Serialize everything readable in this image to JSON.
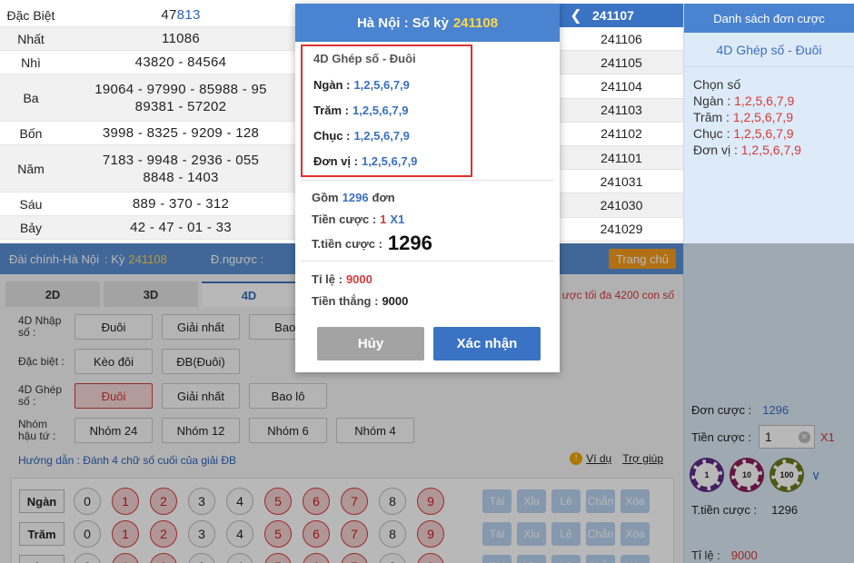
{
  "results": [
    {
      "label": "Đặc Biệt",
      "prefix": "47",
      "highlight": "813"
    },
    {
      "label": "Nhất",
      "value": "11086"
    },
    {
      "label": "Nhì",
      "value": "43820  -  84564"
    },
    {
      "label": "Ba",
      "value": "19064  -  97990  -  85988  -  95\n89381  -  57202"
    },
    {
      "label": "Bốn",
      "value": "3998  -  8325  -  9209  -  128"
    },
    {
      "label": "Năm",
      "value": "7183  -  9948  -  2936  -  055\n8848  -  1403"
    },
    {
      "label": "Sáu",
      "value": "889  -  370  -  312"
    },
    {
      "label": "Bảy",
      "value": "42  -  47  -  01  -  33"
    }
  ],
  "periods": {
    "header": "241107",
    "items": [
      "241106",
      "241105",
      "241104",
      "241103",
      "241102",
      "241101",
      "241031",
      "241030",
      "241029"
    ]
  },
  "right_panel": {
    "header": "Danh sách đơn cược",
    "bet_type": "4D Ghép số - Đuôi",
    "choose_label": "Chọn số",
    "picks": [
      {
        "label": "Ngàn :",
        "value": "1,2,5,6,7,9"
      },
      {
        "label": "Trăm :",
        "value": "1,2,5,6,7,9"
      },
      {
        "label": "Chục :",
        "value": "1,2,5,6,7,9"
      },
      {
        "label": "Đơn vị :",
        "value": "1,2,5,6,7,9"
      }
    ],
    "orders_label": "Đơn cược :",
    "orders_value": "1296",
    "stake_label": "Tiền cược :",
    "stake_value": "1",
    "stake_mult": "X1",
    "chips": [
      "1",
      "10",
      "100"
    ],
    "total_label": "T.tiền cược :",
    "total_value": "1296",
    "rate_label": "Tỉ lệ :",
    "rate_value": "9000"
  },
  "betbar": {
    "station": "Đài chính-Hà Nội",
    "ky_label": ":  Kỳ",
    "ky_value": "241108",
    "reverse_label": "Đ.ngược :",
    "home_button": "Trang chủ"
  },
  "tabs": [
    "2D",
    "3D",
    "4D"
  ],
  "max_info": "ược tối đa 4200 con số",
  "options": [
    {
      "label": "4D Nhập số :",
      "buttons": [
        "Đuôi",
        "Giải nhất",
        "Bao l"
      ]
    },
    {
      "label": "Đặc biệt :",
      "buttons": [
        "Kèo đôi",
        "ĐB(Đuôi)"
      ]
    },
    {
      "label": "4D Ghép số :",
      "buttons": [
        "Đuôi",
        "Giải nhất",
        "Bao lô"
      ]
    },
    {
      "label": "Nhóm hậu tứ :",
      "buttons": [
        "Nhóm 24",
        "Nhóm 12",
        "Nhóm 6",
        "Nhóm 4"
      ]
    }
  ],
  "guide": "Hướng dẫn : Đánh 4 chữ số cuối của giải ĐB",
  "links": {
    "example": "Ví dụ",
    "help": "Trợ giúp"
  },
  "number_rows": [
    {
      "label": "Ngàn"
    },
    {
      "label": "Trăm"
    },
    {
      "label": "Chục"
    }
  ],
  "digits": [
    "0",
    "1",
    "2",
    "3",
    "4",
    "5",
    "6",
    "7",
    "8",
    "9"
  ],
  "selected_digits": [
    "1",
    "2",
    "5",
    "6",
    "7",
    "9"
  ],
  "quick_buttons": [
    "Tài",
    "Xỉu",
    "Lẻ",
    "Chẵn",
    "Xóa"
  ],
  "modal": {
    "title_prefix": "Hà Nội : Số kỳ",
    "title_period": "241108",
    "bet_title": "4D Ghép số - Đuôi",
    "picks": [
      {
        "label": "Ngàn  :",
        "value": "1,2,5,6,7,9"
      },
      {
        "label": "Trăm  :",
        "value": "1,2,5,6,7,9"
      },
      {
        "label": "Chục  :",
        "value": "1,2,5,6,7,9"
      },
      {
        "label": "Đơn vị  :",
        "value": "1,2,5,6,7,9"
      }
    ],
    "count_prefix": "Gồm",
    "count_value": "1296",
    "count_suffix": "đơn",
    "stake_label": "Tiền cược :",
    "stake_value": "1",
    "stake_mult": "X1",
    "total_label": "T.tiền cược :",
    "total_value": "1296",
    "rate_label": "Tỉ lệ  :",
    "rate_value": "9000",
    "win_label": "Tiền thắng :",
    "win_value": "9000",
    "cancel_button": "Hủy",
    "confirm_button": "Xác nhận"
  },
  "colors": {
    "primary": "#3a73c4",
    "accent_yellow": "#ffd84a",
    "red": "#d43a3a",
    "home_orange": "#f79c1c"
  }
}
